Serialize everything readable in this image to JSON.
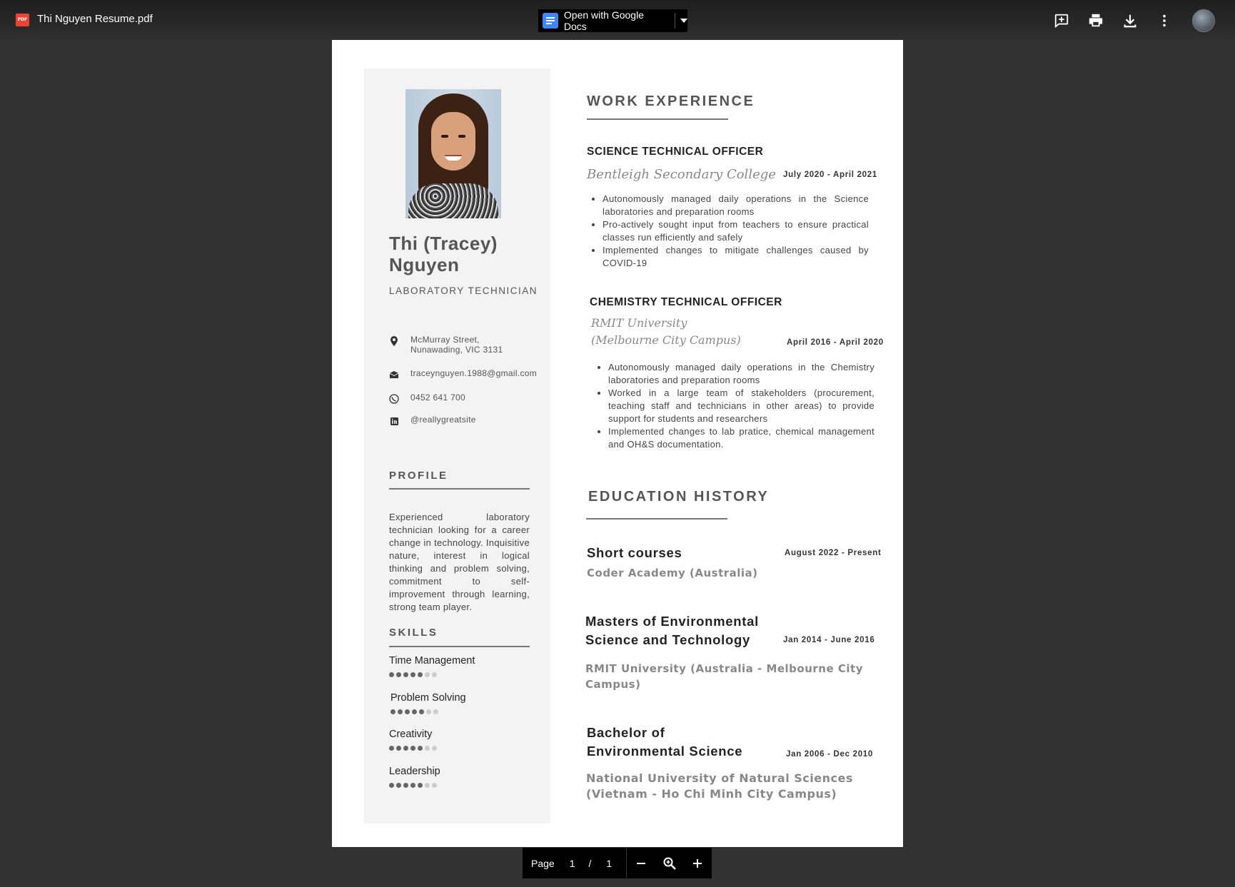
{
  "toolbar": {
    "file_icon_text": "PDF",
    "file_name": "Thi Nguyen Resume.pdf",
    "open_with_label": "Open with Google Docs",
    "icons": [
      "add-comment-icon",
      "print-icon",
      "download-icon",
      "more-vert-icon",
      "account-avatar"
    ]
  },
  "resume": {
    "name_line1": "Thi (Tracey)",
    "name_line2": "Nguyen",
    "role": "LABORATORY TECHNICIAN",
    "contact": {
      "address_line1": "McMurray Street,",
      "address_line2": "Nunawading, VIC 3131",
      "email": "traceynguyen.1988@gmail.com",
      "phone": "0452 641 700",
      "social": "@reallygreatsite"
    },
    "profile_heading": "PROFILE",
    "profile_text": "Experienced laboratory technician looking for a career change in technology. Inquisitive nature, interest in logical thinking and problem solving, commitment to self-improvement through learning, strong team player.",
    "skills_heading": "SKILLS",
    "skills": [
      {
        "name": "Time Management",
        "level": 5,
        "max": 7
      },
      {
        "name": "Problem Solving",
        "level": 5,
        "max": 7
      },
      {
        "name": "Creativity",
        "level": 5,
        "max": 7
      },
      {
        "name": "Leadership",
        "level": 5,
        "max": 7
      }
    ],
    "work_heading": "WORK EXPERIENCE",
    "jobs": [
      {
        "title": "SCIENCE TECHNICAL OFFICER",
        "org": "Bentleigh Secondary College",
        "dates": "July 2020 -  April 2021",
        "bullets": [
          "Autonomously managed daily operations in the Science laboratories and preparation rooms",
          "Pro-actively sought input from teachers to ensure practical classes run efficiently and safely",
          "Implemented changes to mitigate challenges caused by COVID-19"
        ]
      },
      {
        "title": "CHEMISTRY TECHNICAL OFFICER",
        "org_line1": "RMIT University",
        "org_line2": "(Melbourne City Campus)",
        "dates": "April 2016 - April 2020",
        "bullets": [
          "Autonomously managed daily operations in the Chemistry laboratories and preparation rooms",
          "Worked in a large team of stakeholders (procurement, teaching staff and technicians in other areas) to provide support for students and researchers",
          "Implemented changes to lab pratice, chemical management and OH&S documentation."
        ]
      }
    ],
    "education_heading": "EDUCATION HISTORY",
    "education": [
      {
        "title": "Short courses",
        "institution": "Coder Academy (Australia)",
        "dates": "August 2022 - Present"
      },
      {
        "title_line1": "Masters of Environmental",
        "title_line2": "Science and Technology",
        "institution_line1": "RMIT University (Australia - Melbourne City",
        "institution_line2": "Campus)",
        "dates": "Jan 2014 - June 2016"
      },
      {
        "title_line1": "Bachelor of",
        "title_line2": "Environmental Science",
        "institution_line1": "National University of Natural Sciences",
        "institution_line2": "(Vietnam - Ho Chi Minh City Campus)",
        "dates": "Jan 2006 - Dec 2010"
      }
    ]
  },
  "pager": {
    "label": "Page",
    "current": "1",
    "separator": "/",
    "total": "1",
    "icons": [
      "zoom-out-icon",
      "zoom-icon",
      "zoom-in-icon"
    ]
  }
}
